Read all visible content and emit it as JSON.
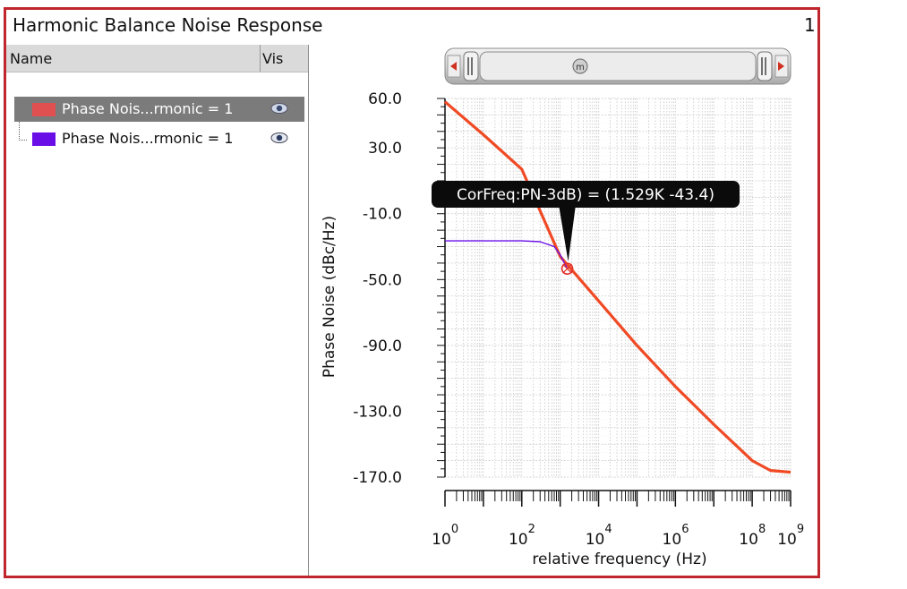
{
  "window": {
    "title": "Harmonic Balance Noise Response",
    "index": "1"
  },
  "browser": {
    "col_name": "Name",
    "col_vis": "Vis",
    "traces": [
      {
        "label": "Phase Nois...rmonic = 1",
        "color": "#e05050",
        "selected": true,
        "icon": "eye-icon"
      },
      {
        "label": "Phase Nois...rmonic = 1",
        "color": "#6a0ee8",
        "selected": false,
        "icon": "eye-icon"
      }
    ]
  },
  "scroller": {
    "thumb_label": "m"
  },
  "marker": {
    "label": "CorFreq:PN-3dB) = (1.529K -43.4)",
    "x": 1529,
    "y": -43.4
  },
  "chart_data": {
    "type": "line",
    "title": "",
    "xlabel": "relative frequency (Hz)",
    "ylabel": "Phase Noise (dBc/Hz)",
    "x_scale": "log",
    "xlim": [
      1,
      1000000000
    ],
    "ylim": [
      -170,
      60
    ],
    "x_tick_labels": [
      {
        "base": "10",
        "exp": "0"
      },
      {
        "base": "10",
        "exp": "2"
      },
      {
        "base": "10",
        "exp": "4"
      },
      {
        "base": "10",
        "exp": "6"
      },
      {
        "base": "10",
        "exp": "8"
      },
      {
        "base": "10",
        "exp": "9"
      }
    ],
    "x_tick_values": [
      1,
      100,
      10000,
      1000000,
      100000000,
      1000000000
    ],
    "y_ticks": [
      "60.0",
      "30.0",
      "-10.0",
      "-50.0",
      "-90.0",
      "-130.0",
      "-170.0"
    ],
    "y_tick_values": [
      60,
      30,
      -10,
      -50,
      -90,
      -130,
      -170
    ],
    "grid": true,
    "series": [
      {
        "color": "#f04a25",
        "x": [
          1,
          10,
          100,
          1000,
          10000,
          100000,
          1000000,
          10000000,
          100000000,
          300000000,
          1000000000
        ],
        "y": [
          58,
          38,
          17,
          -36,
          -63,
          -90,
          -115,
          -138,
          -160,
          -166,
          -167
        ]
      },
      {
        "color": "#6a0ee8",
        "x": [
          1,
          10,
          100,
          300,
          700,
          1000,
          1529
        ],
        "y": [
          -26.5,
          -26.5,
          -26.5,
          -27,
          -30,
          -35,
          -43.4
        ]
      }
    ]
  }
}
